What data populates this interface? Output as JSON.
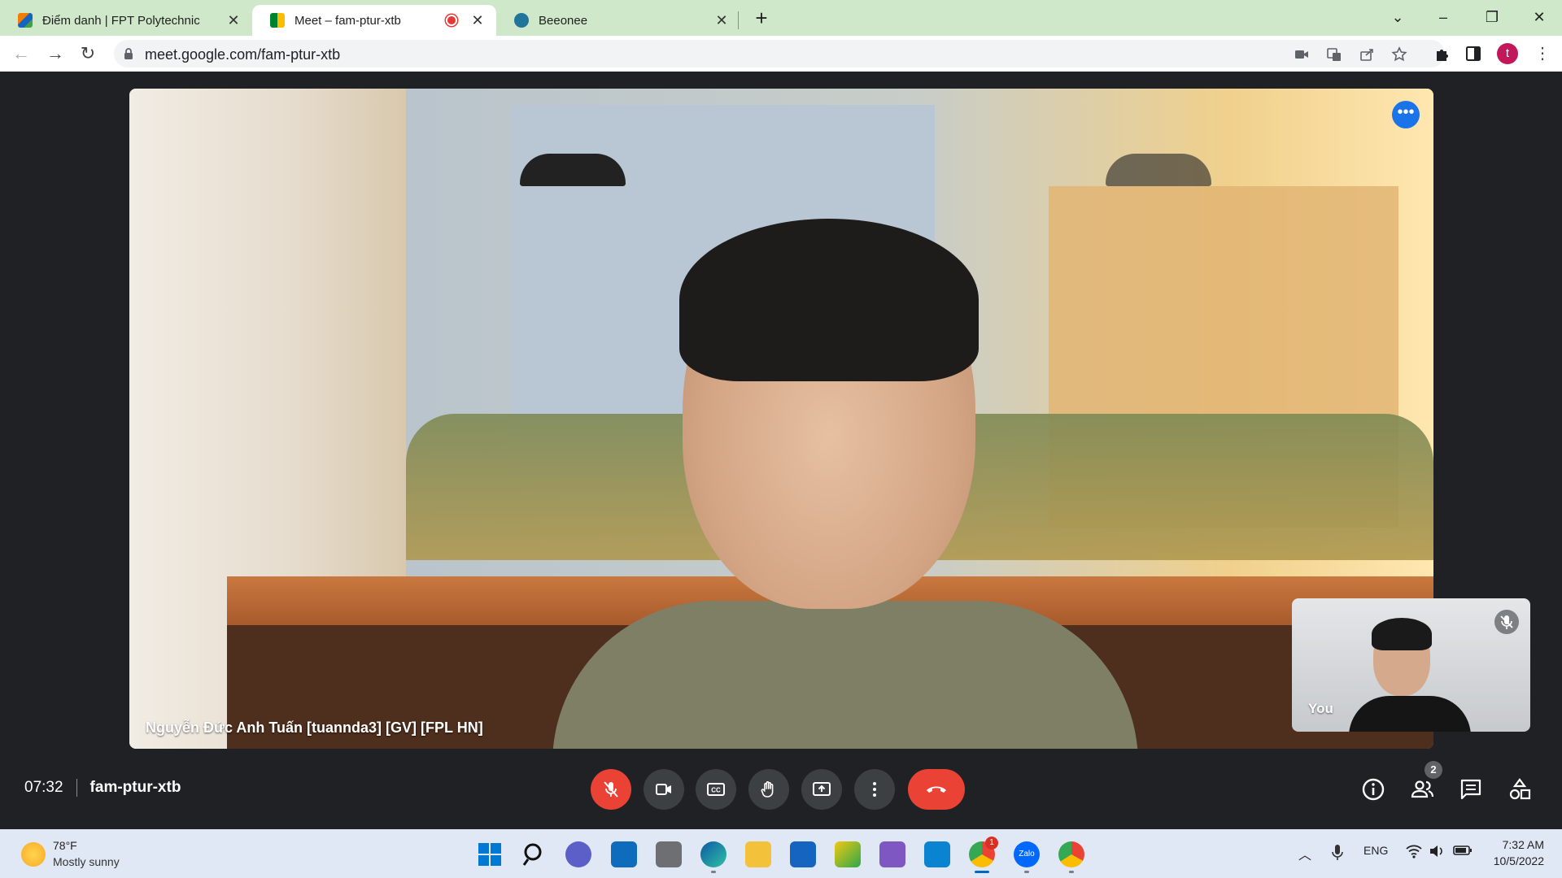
{
  "browser": {
    "tabs": [
      {
        "title": "Điểm danh | FPT Polytechnic",
        "active": false
      },
      {
        "title": "Meet – fam-ptur-xtb",
        "active": true,
        "recording": true
      },
      {
        "title": "Beeonee",
        "active": false
      }
    ],
    "url": "meet.google.com/fam-ptur-xtb",
    "profile_initial": "t"
  },
  "meet": {
    "main_participant": "Nguyễn Đức Anh Tuấn [tuannda3] [GV] [FPL HN]",
    "self_label": "You",
    "time": "07:32",
    "meeting_code": "fam-ptur-xtb",
    "participant_count": "2",
    "mic_muted": true,
    "colors": {
      "danger": "#ea4335",
      "control_bg": "#3c4043",
      "accent": "#1a73e8"
    }
  },
  "taskbar": {
    "weather_temp": "78°F",
    "weather_desc": "Mostly sunny",
    "language": "ENG",
    "time": "7:32 AM",
    "date": "10/5/2022",
    "chrome_badge": "1",
    "zalo_label": "Zalo"
  }
}
